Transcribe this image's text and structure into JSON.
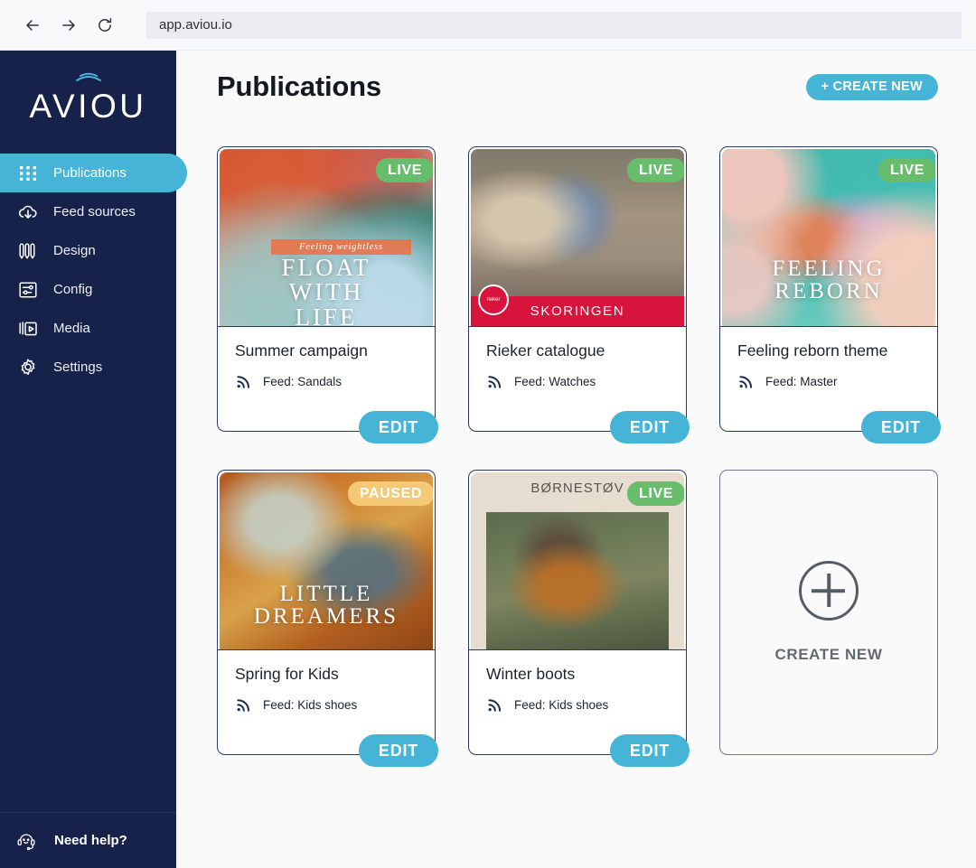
{
  "browser": {
    "url": "app.aviou.io",
    "back_icon": "arrow-left-icon",
    "forward_icon": "arrow-right-icon",
    "reload_icon": "reload-icon"
  },
  "sidebar": {
    "logo_text": "AVIOU",
    "items": [
      {
        "label": "Publications",
        "icon": "grid-dots-icon",
        "active": true
      },
      {
        "label": "Feed sources",
        "icon": "cloud-download-icon",
        "active": false
      },
      {
        "label": "Design",
        "icon": "pencils-icon",
        "active": false
      },
      {
        "label": "Config",
        "icon": "sliders-icon",
        "active": false
      },
      {
        "label": "Media",
        "icon": "media-folder-icon",
        "active": false
      },
      {
        "label": "Settings",
        "icon": "gear-icon",
        "active": false
      }
    ],
    "help": {
      "label": "Need help?",
      "icon": "headset-support-icon"
    }
  },
  "header": {
    "title": "Publications",
    "create_button": "+ CREATE NEW"
  },
  "cards": [
    {
      "title": "Summer campaign",
      "feed": "Feed: Sandals",
      "status": "LIVE",
      "status_kind": "live",
      "edit_label": "EDIT",
      "art_headline": "FLOAT\nWITH\nLIFE",
      "art_ribbon": "Feeling weightless"
    },
    {
      "title": "Rieker catalogue",
      "feed": "Feed: Watches",
      "status": "LIVE",
      "status_kind": "live",
      "edit_label": "EDIT",
      "art_brand": "SKORINGEN",
      "art_logo": "rieker"
    },
    {
      "title": "Feeling reborn theme",
      "feed": "Feed: Master",
      "status": "LIVE",
      "status_kind": "live",
      "edit_label": "EDIT",
      "art_headline": "FEELING\nREBORN"
    },
    {
      "title": "Spring for Kids",
      "feed": "Feed: Kids shoes",
      "status": "PAUSED",
      "status_kind": "paused",
      "edit_label": "EDIT",
      "art_headline": "LITTLE\nDREAMERS"
    },
    {
      "title": "Winter boots",
      "feed": "Feed: Kids shoes",
      "status": "LIVE",
      "status_kind": "live",
      "edit_label": "EDIT",
      "art_brand": "BØRNESTØV"
    }
  ],
  "create_card": {
    "label": "CREATE NEW",
    "icon": "plus-circle-icon"
  },
  "colors": {
    "sidebar_bg": "#17224b",
    "accent": "#45b4d6",
    "live_green": "#68bd6c",
    "paused_amber": "#f5c976",
    "card_border": "#2c3a63",
    "page_bg": "#fafafa"
  }
}
